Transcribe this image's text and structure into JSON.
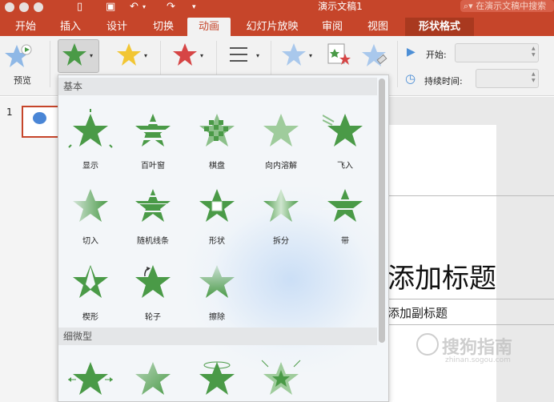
{
  "window": {
    "title": "演示文稿1",
    "search_placeholder": "在演示文稿中搜索"
  },
  "tabs": [
    {
      "label": "开始"
    },
    {
      "label": "插入"
    },
    {
      "label": "设计"
    },
    {
      "label": "切换"
    },
    {
      "label": "动画"
    },
    {
      "label": "幻灯片放映"
    },
    {
      "label": "审阅"
    },
    {
      "label": "视图"
    },
    {
      "label": "形状格式"
    }
  ],
  "active_tab": "动画",
  "ribbon": {
    "preview_label": "预览",
    "start_label": "开始:",
    "duration_label": "持续时间:",
    "start_value": "",
    "duration_value": ""
  },
  "gallery": {
    "section_basic": "基本",
    "section_subtle": "细微型",
    "basic_effects": [
      {
        "label": "显示"
      },
      {
        "label": "百叶窗"
      },
      {
        "label": "棋盘"
      },
      {
        "label": "向内溶解"
      },
      {
        "label": "飞入"
      },
      {
        "label": "切入"
      },
      {
        "label": "随机线条"
      },
      {
        "label": "形状"
      },
      {
        "label": "拆分"
      },
      {
        "label": "带"
      },
      {
        "label": "楔形"
      },
      {
        "label": "轮子"
      },
      {
        "label": "擦除"
      }
    ]
  },
  "slides": {
    "thumb_number": "1"
  },
  "slide": {
    "title": "添加标题",
    "subtitle": "添加副标题"
  },
  "watermark": {
    "text": "搜狗指南",
    "url": "zhinan.sogou.com"
  },
  "colors": {
    "accent": "#c6452a",
    "star_green": "#4a9a47",
    "star_yellow": "#f2c634",
    "star_red": "#d64545",
    "star_blue": "#8fb8e6"
  }
}
